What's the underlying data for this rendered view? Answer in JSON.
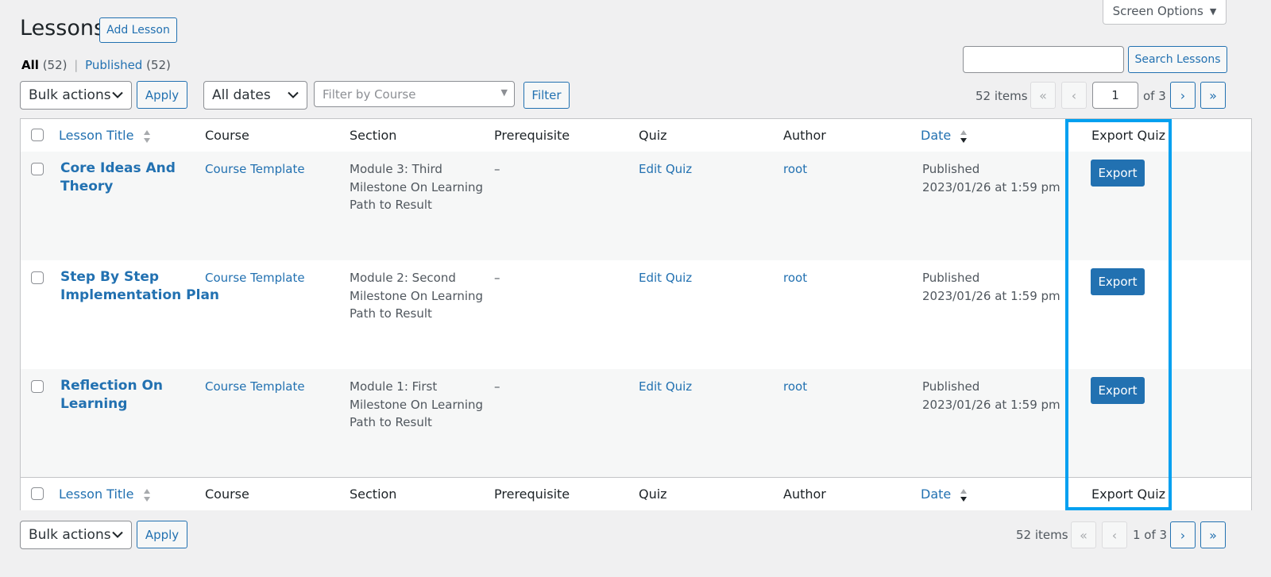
{
  "header": {
    "title": "Lessons",
    "add_label": "Add Lesson",
    "screen_options": "Screen Options"
  },
  "views": {
    "all_label": "All",
    "all_count": "(52)",
    "sep": "|",
    "published_label": "Published",
    "published_count": "(52)"
  },
  "search": {
    "value": "",
    "button": "Search Lessons"
  },
  "toolbar": {
    "bulk_actions": "Bulk actions",
    "apply": "Apply",
    "all_dates": "All dates",
    "filter_course_placeholder": "Filter by Course",
    "filter": "Filter"
  },
  "pagination_top": {
    "items": "52 items",
    "first": "«",
    "prev": "‹",
    "current": "1",
    "of": "of 3",
    "next": "›",
    "last": "»"
  },
  "pagination_bottom": {
    "items": "52 items",
    "first": "«",
    "prev": "‹",
    "text": "1 of 3",
    "next": "›",
    "last": "»"
  },
  "columns": {
    "title": "Lesson Title",
    "course": "Course",
    "section": "Section",
    "prerequisite": "Prerequisite",
    "quiz": "Quiz",
    "author": "Author",
    "date": "Date",
    "export": "Export Quiz"
  },
  "rows": [
    {
      "title_line1": "Core Ideas And",
      "title_line2": "Theory",
      "course": "Course Template",
      "section_line1": "Module 3: Third",
      "section_line2": "Milestone On Learning",
      "section_line3": "Path to Result",
      "prerequisite": "–",
      "quiz": "Edit Quiz",
      "author": "root",
      "status": "Published",
      "date": "2023/01/26 at 1:59 pm",
      "export": "Export"
    },
    {
      "title_line1": "Step By Step",
      "title_line2": "Implementation Plan",
      "course": "Course Template",
      "section_line1": "Module 2: Second",
      "section_line2": "Milestone On Learning",
      "section_line3": "Path to Result",
      "prerequisite": "–",
      "quiz": "Edit Quiz",
      "author": "root",
      "status": "Published",
      "date": "2023/01/26 at 1:59 pm",
      "export": "Export"
    },
    {
      "title_line1": "Reflection On",
      "title_line2": "Learning",
      "course": "Course Template",
      "section_line1": "Module 1: First",
      "section_line2": "Milestone On Learning",
      "section_line3": "Path to Result",
      "prerequisite": "–",
      "quiz": "Edit Quiz",
      "author": "root",
      "status": "Published",
      "date": "2023/01/26 at 1:59 pm",
      "export": "Export"
    }
  ],
  "colors": {
    "link": "#2271b1",
    "highlight": "#00a0f0",
    "button": "#2271b1"
  }
}
